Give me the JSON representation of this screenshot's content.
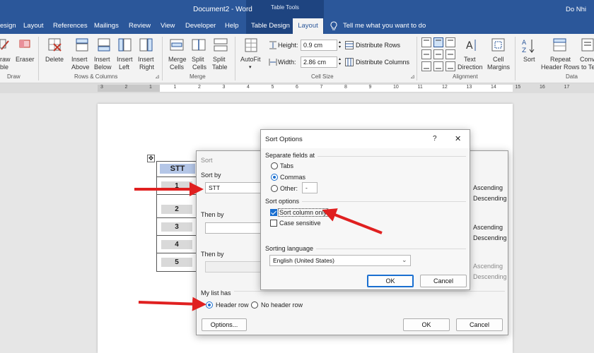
{
  "window": {
    "title": "Document2 - Word",
    "context_tab_group": "Table Tools",
    "user": "Do Nhi"
  },
  "tabs": [
    {
      "label": "esign"
    },
    {
      "label": "Layout"
    },
    {
      "label": "References"
    },
    {
      "label": "Mailings"
    },
    {
      "label": "Review"
    },
    {
      "label": "View"
    },
    {
      "label": "Developer"
    },
    {
      "label": "Help"
    },
    {
      "label": "Table Design"
    },
    {
      "label": "Layout"
    },
    {
      "label": "Tell me what you want to do"
    }
  ],
  "ribbon": {
    "draw_labels": [
      "raw",
      "ble",
      "Eraser"
    ],
    "delete": "Delete",
    "insert_above": [
      "Insert",
      "Above"
    ],
    "insert_below": [
      "Insert",
      "Below"
    ],
    "insert_left": [
      "Insert",
      "Left"
    ],
    "insert_right": [
      "Insert",
      "Right"
    ],
    "merge_cells": [
      "Merge",
      "Cells"
    ],
    "split_cells": [
      "Split",
      "Cells"
    ],
    "split_table": [
      "Split",
      "Table"
    ],
    "autofit": "AutoFit",
    "height_label": "Height:",
    "height_value": "0.9 cm",
    "width_label": "Width:",
    "width_value": "2.86 cm",
    "distribute_rows": "Distribute Rows",
    "distribute_columns": "Distribute Columns",
    "text_direction": [
      "Text",
      "Direction"
    ],
    "cell_margins": [
      "Cell",
      "Margins"
    ],
    "sort": "Sort",
    "repeat_header_rows": [
      "Repeat",
      "Header Rows"
    ],
    "convert": [
      "Conv",
      "to Te"
    ],
    "groups": {
      "draw": "Draw",
      "rows_columns": "Rows & Columns",
      "merge": "Merge",
      "cell_size": "Cell Size",
      "alignment": "Alignment",
      "data": "Data"
    }
  },
  "ruler": {
    "numbers": [
      "3",
      "2",
      "1",
      "1",
      "2",
      "3",
      "4",
      "5",
      "6",
      "7",
      "8",
      "9",
      "10",
      "11",
      "12",
      "13",
      "14",
      "15",
      "16",
      "17"
    ]
  },
  "table": {
    "header": "STT",
    "rows": [
      "1",
      "2",
      "3",
      "4",
      "5"
    ]
  },
  "sort_dialog": {
    "title": "Sort",
    "sort_by_label": "Sort by",
    "sort_by_value": "STT",
    "then_by_label_1": "Then by",
    "then_by_label_2": "Then by",
    "ascending": "Ascending",
    "descending": "Descending",
    "my_list_has": "My list has",
    "header_row": "Header row",
    "no_header_row": "No header row",
    "options_button": "Options...",
    "ok": "OK",
    "cancel": "Cancel"
  },
  "options_dialog": {
    "title": "Sort Options",
    "help": "?",
    "close": "✕",
    "separate_fields_at": "Separate fields at",
    "tabs": "Tabs",
    "commas": "Commas",
    "other": "Other:",
    "other_value": "-",
    "sort_options": "Sort options",
    "sort_column_only": "Sort column only",
    "case_sensitive": "Case sensitive",
    "sorting_language": "Sorting language",
    "language_value": "English (United States)",
    "ok": "OK",
    "cancel": "Cancel"
  },
  "colors": {
    "word_blue": "#2b579a",
    "accent": "#1a6fd0",
    "arrow_red": "#e02020"
  }
}
